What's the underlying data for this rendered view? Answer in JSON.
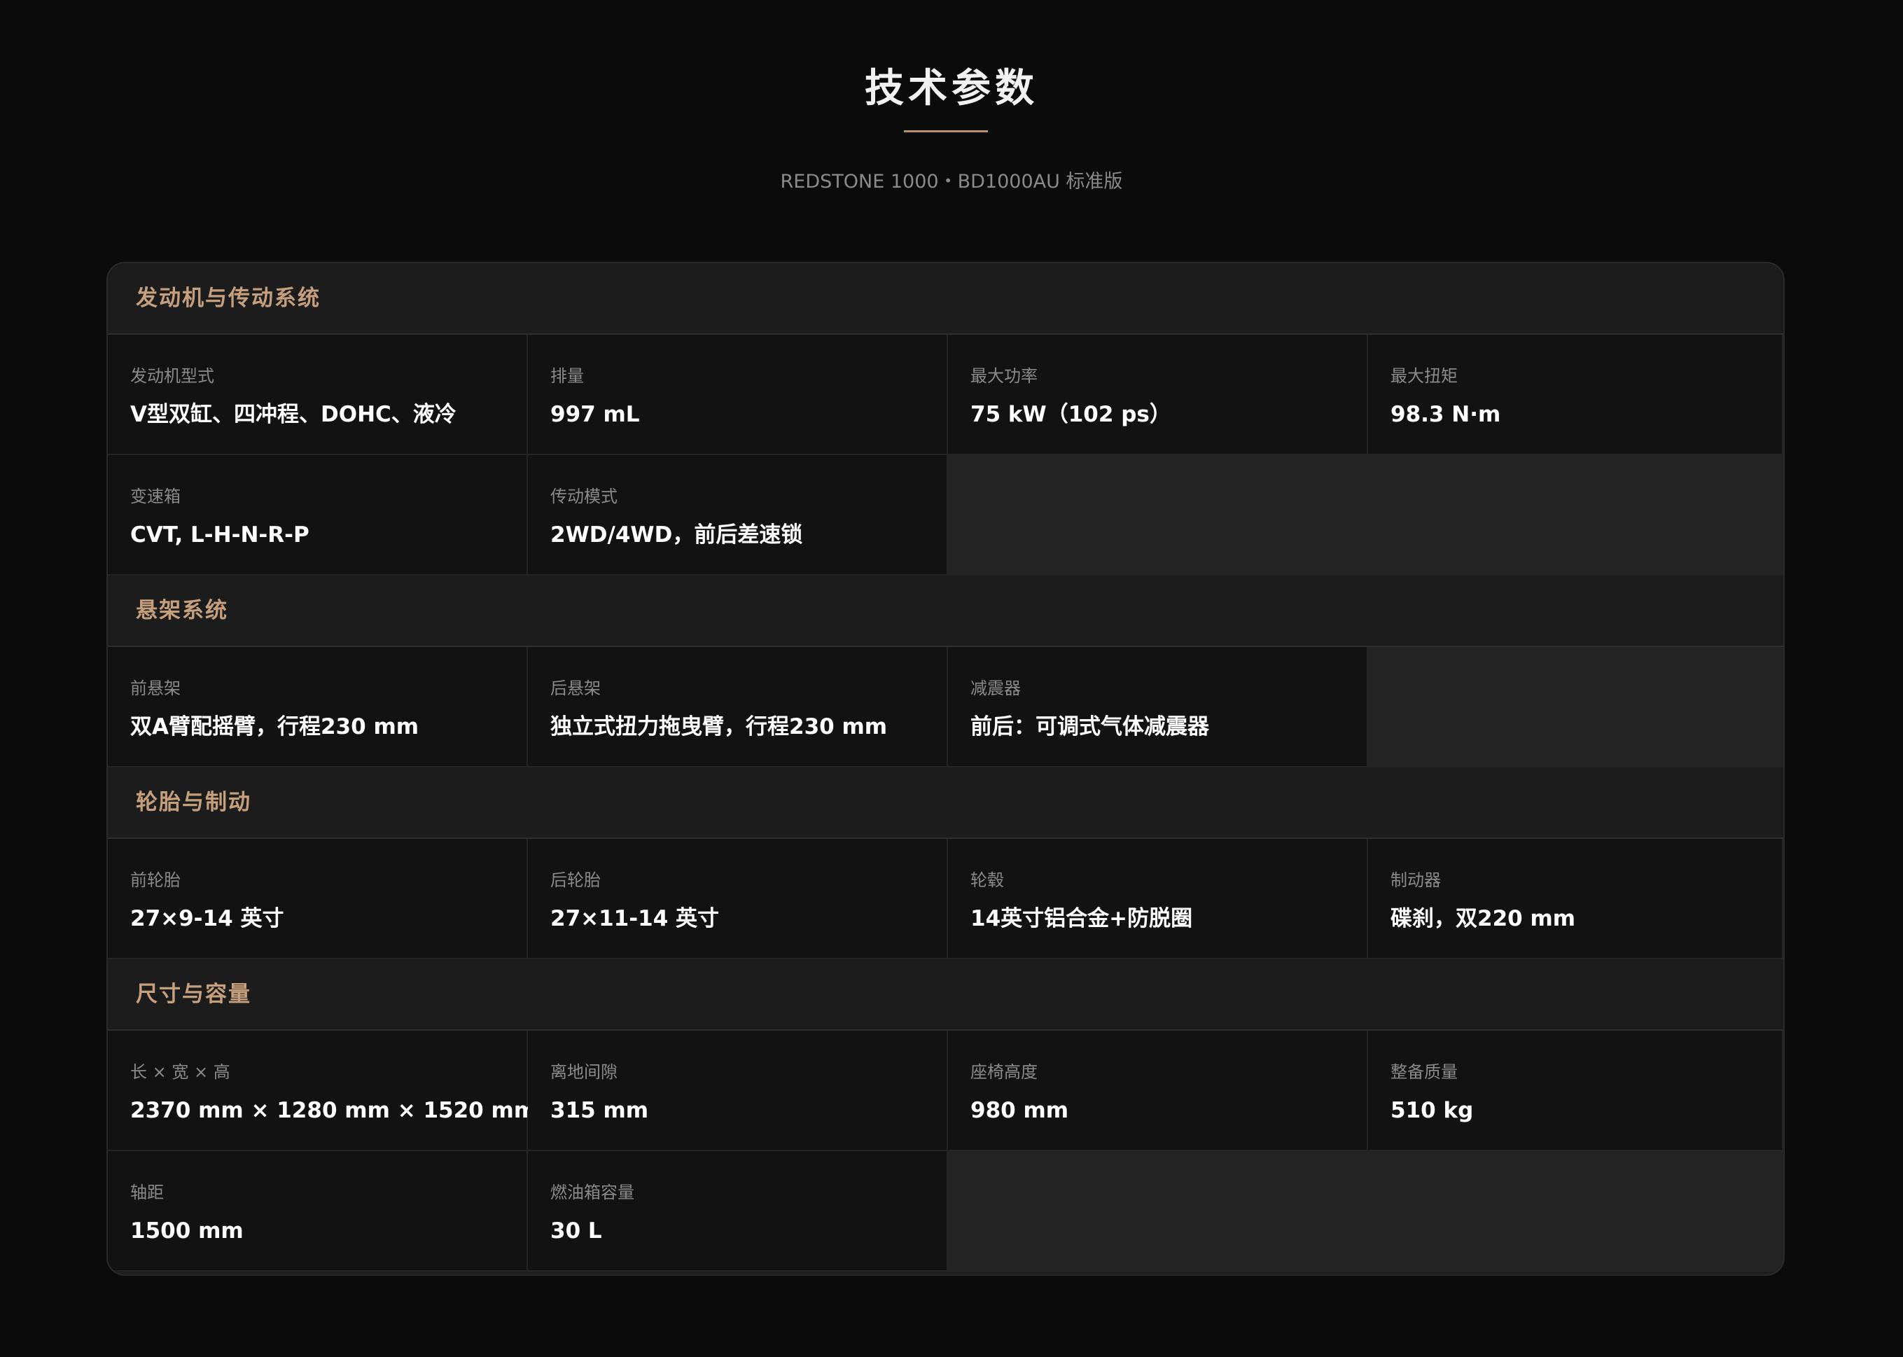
{
  "header": {
    "title": "技术参数",
    "subtitle": "REDSTONE 1000・BD1000AU 标准版"
  },
  "colors": {
    "accent": "#c6a07c",
    "background": "#0b0b0b",
    "cell": "#121212",
    "empty_cell": "#232323"
  },
  "sections": [
    {
      "title": "发动机与传动系统",
      "rows": [
        [
          {
            "label": "发动机型式",
            "value": "V型双缸、四冲程、DOHC、液冷"
          },
          {
            "label": "排量",
            "value": "997 mL"
          },
          {
            "label": "最大功率",
            "value": "75 kW（102 ps）"
          },
          {
            "label": "最大扭矩",
            "value": "98.3 N·m"
          }
        ],
        [
          {
            "label": "变速箱",
            "value": "CVT, L-H-N-R-P"
          },
          {
            "label": "传动模式",
            "value": "2WD/4WD，前后差速锁"
          }
        ]
      ]
    },
    {
      "title": "悬架系统",
      "rows": [
        [
          {
            "label": "前悬架",
            "value": "双A臂配摇臂，行程230 mm"
          },
          {
            "label": "后悬架",
            "value": "独立式扭力拖曳臂，行程230 mm"
          },
          {
            "label": "减震器",
            "value": "前后：可调式气体减震器"
          }
        ]
      ]
    },
    {
      "title": "轮胎与制动",
      "rows": [
        [
          {
            "label": "前轮胎",
            "value": "27×9-14 英寸"
          },
          {
            "label": "后轮胎",
            "value": "27×11-14 英寸"
          },
          {
            "label": "轮毂",
            "value": "14英寸铝合金+防脱圈"
          },
          {
            "label": "制动器",
            "value": "碟刹，双220 mm"
          }
        ]
      ]
    },
    {
      "title": "尺寸与容量",
      "rows": [
        [
          {
            "label": "长 × 宽 × 高",
            "value": "2370 mm × 1280 mm × 1520 mm"
          },
          {
            "label": "离地间隙",
            "value": "315 mm"
          },
          {
            "label": "座椅高度",
            "value": "980 mm"
          },
          {
            "label": "整备质量",
            "value": "510 kg"
          }
        ],
        [
          {
            "label": "轴距",
            "value": "1500 mm"
          },
          {
            "label": "燃油箱容量",
            "value": "30 L"
          }
        ]
      ]
    }
  ]
}
